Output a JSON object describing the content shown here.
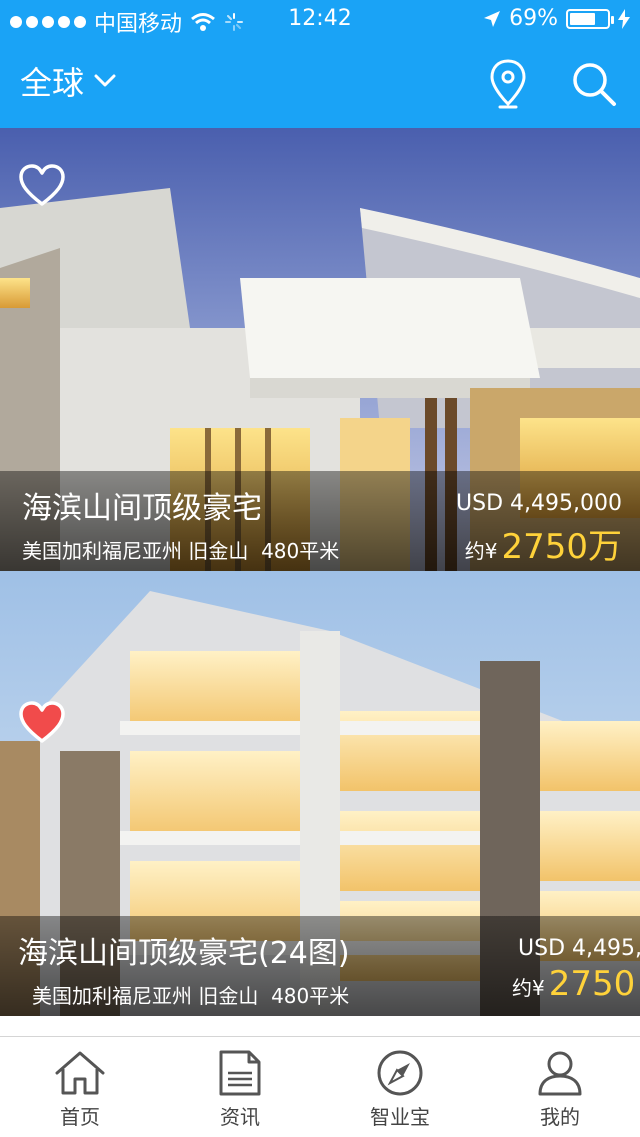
{
  "status": {
    "carrier": "中国移动",
    "time": "12:42",
    "battery": "69%",
    "battery_level": 0.69
  },
  "header": {
    "region": "全球",
    "icons": [
      "location-pin-icon",
      "search-icon"
    ]
  },
  "listings": [
    {
      "title": "海滨山间顶级豪宅",
      "location": "美国加利福尼亚州 旧金山",
      "area": "480平米",
      "price_usd": "USD  4,495,000",
      "price_prefix": "约¥",
      "price_cny": "2750万",
      "favorited": false
    },
    {
      "title": "海滨山间顶级豪宅(24图)",
      "location": "美国加利福尼亚州 旧金山",
      "area": "480平米",
      "price_usd": "USD  4,495,",
      "price_prefix": "约¥",
      "price_cny": "2750",
      "favorited": true
    }
  ],
  "tabs": [
    {
      "label": "首页",
      "icon": "home-icon"
    },
    {
      "label": "资讯",
      "icon": "news-icon"
    },
    {
      "label": "智业宝",
      "icon": "compass-icon"
    },
    {
      "label": "我的",
      "icon": "user-icon"
    }
  ],
  "colors": {
    "accent": "#1aa3f6",
    "price": "#ffd23a",
    "heart_active": "#f14b4b"
  }
}
